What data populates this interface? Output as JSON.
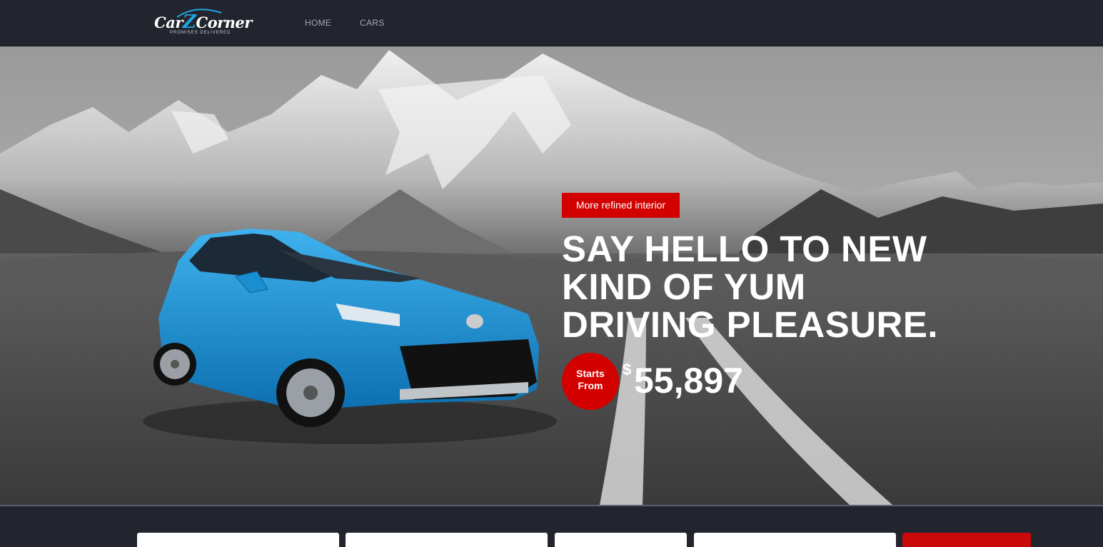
{
  "brand": {
    "logo_text_left": "Car",
    "logo_text_z": "Z",
    "logo_text_right": "Corner",
    "tagline": "Promises Delivered",
    "accent_color": "#1fa6e0"
  },
  "nav": {
    "items": [
      {
        "label": "HOME"
      },
      {
        "label": "CARS"
      }
    ]
  },
  "hero": {
    "badge_label": "More refined interior",
    "headline": "SAY HELLO TO NEW KIND OF YUM DRIVING PLEASURE.",
    "price_prefix_line1": "Starts",
    "price_prefix_line2": "From",
    "currency_symbol": "$",
    "price": "55,897",
    "accent_color": "#d30000",
    "car_color": "#1a8fd0"
  },
  "search": {
    "fields": [
      "",
      "",
      "",
      ""
    ],
    "button_label": ""
  }
}
